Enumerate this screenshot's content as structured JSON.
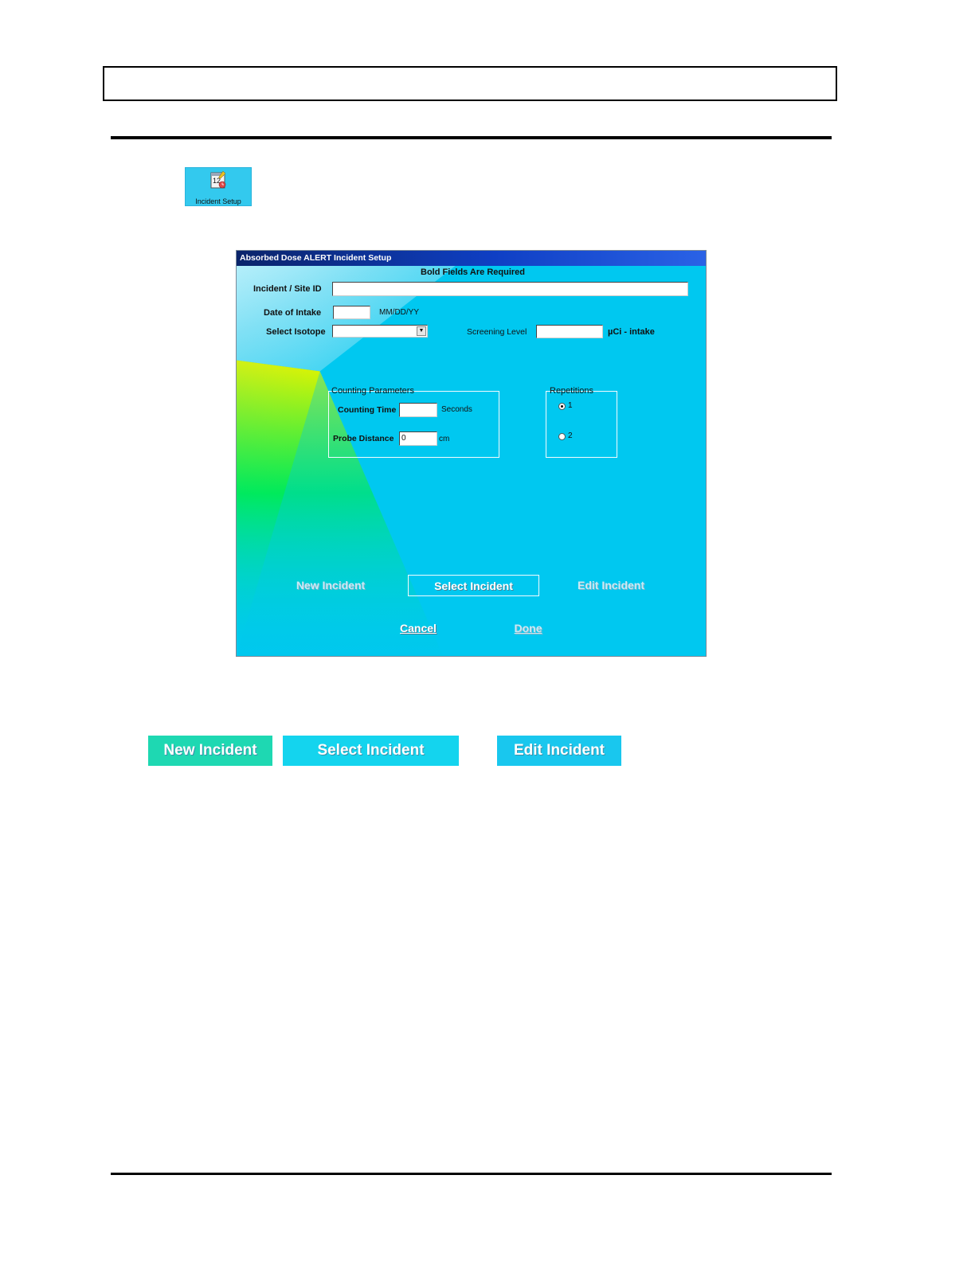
{
  "desktop_icon": {
    "caption": "Incident Setup",
    "icon": "calendar-clock-icon",
    "glyph_text": "12"
  },
  "dialog": {
    "title": "Absorbed Dose ALERT  Incident Setup",
    "required_note": "Bold Fields Are Required",
    "incident_site_label": "Incident / Site ID",
    "incident_site_value": "",
    "date_label": "Date of Intake",
    "date_value": "",
    "date_format": "MM/DD/YY",
    "isotope_label": "Select Isotope",
    "isotope_value": "",
    "screening_label": "Screening Level",
    "screening_value": "",
    "screening_unit": "µCi - intake",
    "counting_group": {
      "title": "Counting Parameters",
      "counting_time_label": "Counting Time",
      "counting_time_value": "",
      "counting_time_unit": "Seconds",
      "probe_distance_label": "Probe Distance",
      "probe_distance_value": "0",
      "probe_distance_unit": "cm"
    },
    "repetitions_group": {
      "title": "Repetitions",
      "options": [
        {
          "label": "1",
          "selected": true
        },
        {
          "label": "2",
          "selected": false
        }
      ]
    },
    "buttons": {
      "new_incident": "New Incident",
      "select_incident": "Select Incident",
      "edit_incident": "Edit Incident",
      "cancel": "Cancel",
      "done": "Done"
    }
  },
  "sample_buttons": {
    "new_incident": "New Incident",
    "select_incident": "Select Incident",
    "edit_incident": "Edit Incident"
  },
  "colors": {
    "dialog_cyan": "#00c8f0",
    "dialog_green": "#00f050",
    "dialog_yellow": "#e8f000",
    "titlebar": "#0a246a",
    "sample_new": "#1ed8b2",
    "sample_select": "#14d4ee",
    "sample_edit": "#19c7ee"
  }
}
